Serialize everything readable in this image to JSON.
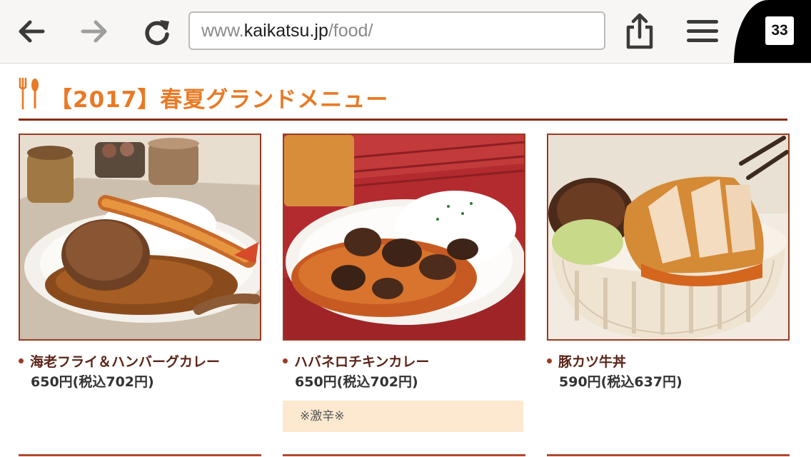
{
  "browser": {
    "url_scheme": "www.",
    "url_host": "kaikatsu.jp",
    "url_path": "/food/",
    "tab_count": "33"
  },
  "icons": {
    "back": "arrow-left-icon",
    "forward": "arrow-right-icon",
    "reload": "reload-icon",
    "share": "share-icon",
    "menu": "hamburger-menu-icon",
    "section": "fork-spoon-icon"
  },
  "colors": {
    "title": "#e87a25",
    "rule": "#8b2a18",
    "item_name": "#5a2417",
    "note_bg": "#fde9d0"
  },
  "section": {
    "title": "【2017】春夏グランドメニュー"
  },
  "menu_items": [
    {
      "name": "海老フライ＆ハンバーグカレー",
      "price": "650円(税込702円)"
    },
    {
      "name": "ハバネロチキンカレー",
      "price": "650円(税込702円)",
      "note": "※激辛※"
    },
    {
      "name": "豚カツ牛丼",
      "price": "590円(税込637円)"
    }
  ]
}
